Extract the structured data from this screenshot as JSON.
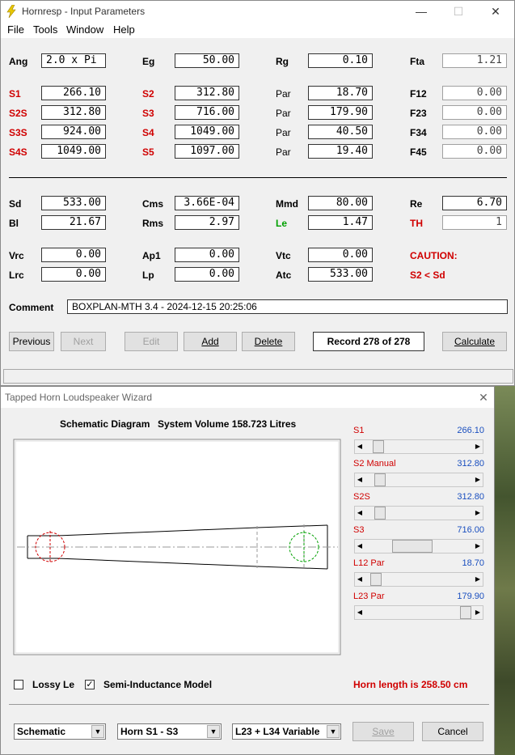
{
  "window1": {
    "title": "Hornresp - Input Parameters",
    "menu": [
      "File",
      "Tools",
      "Window",
      "Help"
    ],
    "row1": [
      {
        "label": "Ang",
        "value": "2.0 x Pi"
      },
      {
        "label": "Eg",
        "value": "50.00"
      },
      {
        "label": "Rg",
        "value": "0.10"
      },
      {
        "label": "Fta",
        "value": "1.21"
      }
    ],
    "sections": [
      {
        "label": "S1",
        "value": "266.10"
      },
      {
        "label": "S2",
        "value": "312.80"
      },
      {
        "label": "Par",
        "value": "18.70"
      },
      {
        "label": "F12",
        "value": "0.00"
      },
      {
        "label": "S2S",
        "value": "312.80"
      },
      {
        "label": "S3",
        "value": "716.00"
      },
      {
        "label": "Par",
        "value": "179.90"
      },
      {
        "label": "F23",
        "value": "0.00"
      },
      {
        "label": "S3S",
        "value": "924.00"
      },
      {
        "label": "S4",
        "value": "1049.00"
      },
      {
        "label": "Par",
        "value": "40.50"
      },
      {
        "label": "F34",
        "value": "0.00"
      },
      {
        "label": "S4S",
        "value": "1049.00"
      },
      {
        "label": "S5",
        "value": "1097.00"
      },
      {
        "label": "Par",
        "value": "19.40"
      },
      {
        "label": "F45",
        "value": "0.00"
      }
    ],
    "driver": [
      {
        "label": "Sd",
        "value": "533.00"
      },
      {
        "label": "Cms",
        "value": "3.66E-04"
      },
      {
        "label": "Mmd",
        "value": "80.00"
      },
      {
        "label": "Re",
        "value": "6.70"
      },
      {
        "label": "Bl",
        "value": "21.67"
      },
      {
        "label": "Rms",
        "value": "2.97"
      },
      {
        "label": "Le",
        "value": "1.47"
      },
      {
        "label": "TH",
        "value": "1"
      }
    ],
    "chamber": [
      {
        "label": "Vrc",
        "value": "0.00"
      },
      {
        "label": "Ap1",
        "value": "0.00"
      },
      {
        "label": "Vtc",
        "value": "0.00"
      },
      {
        "label": "Lrc",
        "value": "0.00"
      },
      {
        "label": "Lp",
        "value": "0.00"
      },
      {
        "label": "Atc",
        "value": "533.00"
      }
    ],
    "caution_title": "CAUTION:",
    "caution_text": "S2 < Sd",
    "comment_label": "Comment",
    "comment_value": "BOXPLAN-MTH 3.4 - 2024-12-15 20:25:06",
    "buttons": {
      "previous": "Previous",
      "next": "Next",
      "edit": "Edit",
      "add": "Add",
      "delete": "Delete",
      "record": "Record 278 of 278",
      "calculate": "Calculate"
    }
  },
  "window2": {
    "title": "Tapped Horn Loudspeaker Wizard",
    "schematic_label": "Schematic Diagram",
    "volume_label": "System Volume 158.723 Litres",
    "sliders": [
      {
        "label": "S1",
        "value": "266.10",
        "pos": 0.08
      },
      {
        "label": "S2  Manual",
        "value": "312.80",
        "pos": 0.1
      },
      {
        "label": "S2S",
        "value": "312.80",
        "pos": 0.1
      },
      {
        "label": "S3",
        "value": "716.00",
        "pos": 0.4
      },
      {
        "label": "L12  Par",
        "value": "18.70",
        "pos": 0.06
      },
      {
        "label": "L23  Par",
        "value": "179.90",
        "pos": 0.97
      }
    ],
    "lossy_le": "Lossy Le",
    "semi_inductance": "Semi-Inductance Model",
    "semi_checked": "✓",
    "horn_length": "Horn length is 258.50 cm",
    "combo1": "Schematic",
    "combo2": "Horn S1 - S3",
    "combo3": "L23 + L34 Variable",
    "save": "Save",
    "cancel": "Cancel"
  }
}
